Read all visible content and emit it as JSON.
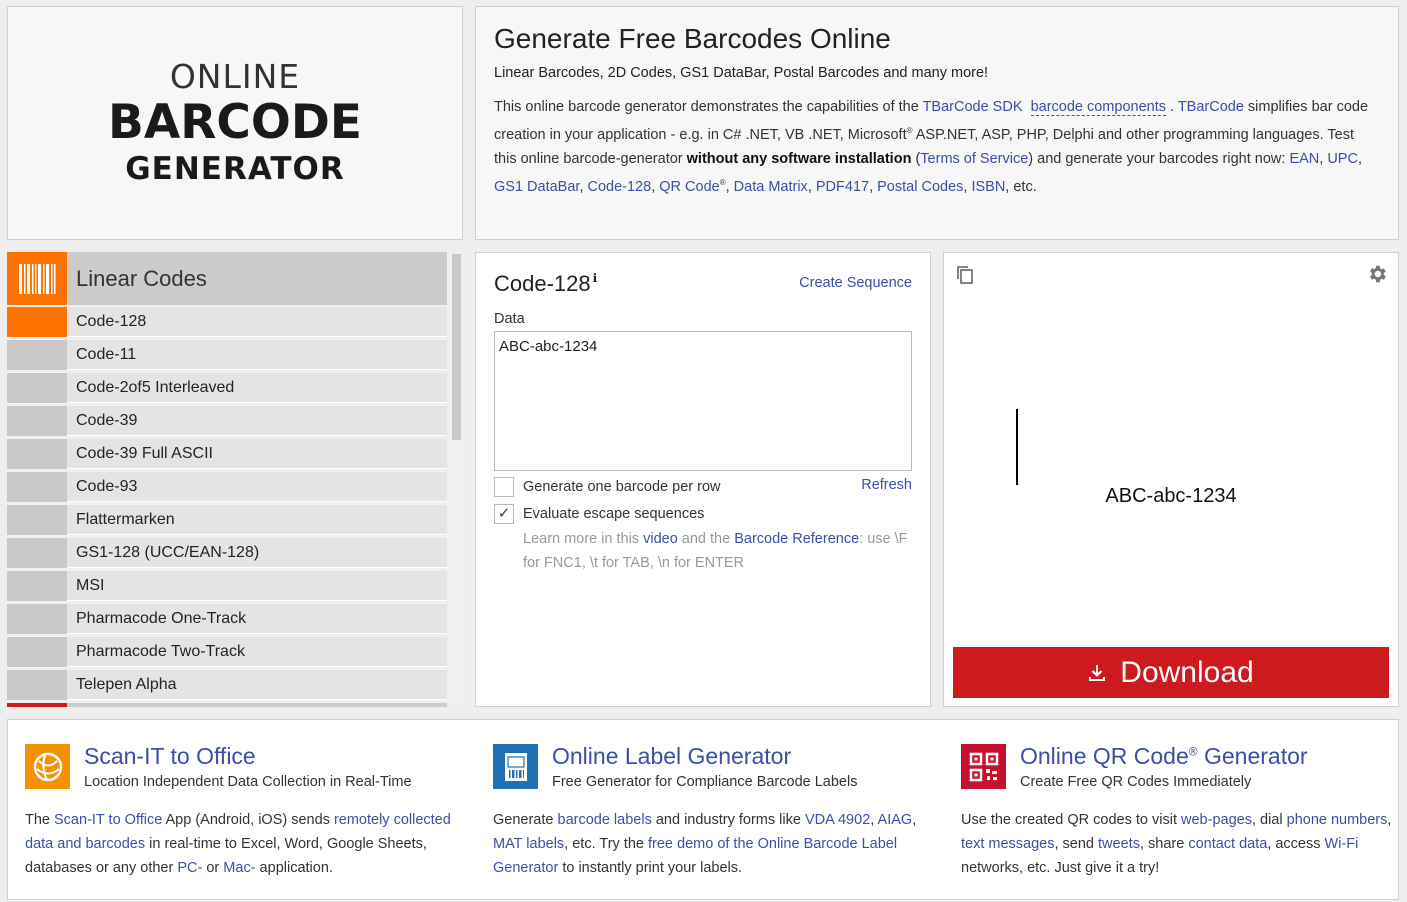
{
  "logo": {
    "line1": "ONLINE",
    "line2": "BARCODE",
    "line3": "GENERATOR"
  },
  "intro": {
    "title": "Generate Free Barcodes Online",
    "subtitle": "Linear Barcodes, 2D Codes, GS1 DataBar, Postal Barcodes and many more!",
    "p1": "This online barcode generator demonstrates the capabilities of the ",
    "tbarcode_sdk": "TBarCode SDK",
    "barcode_components": "barcode components",
    "dot": " . ",
    "tbarcode": "TBarCode",
    "p2": " simplifies bar code creation in your application - e.g. in C# .NET, VB .NET, Microsoft",
    "reg": "®",
    "p3": " ASP.NET, ASP, PHP, Delphi and other programming languages. Test this online barcode-generator ",
    "bold": "without any software installation",
    "p4": " (",
    "terms": "Terms of Service",
    "p5": ") and generate your barcodes right now: ",
    "links": [
      "EAN",
      "UPC",
      "GS1 DataBar",
      "Code-128",
      "QR Code",
      "Data Matrix",
      "PDF417",
      "Postal Codes",
      "ISBN"
    ],
    "etc": ", etc."
  },
  "list": {
    "category": "Linear Codes",
    "items": [
      "Code-128",
      "Code-11",
      "Code-2of5 Interleaved",
      "Code-39",
      "Code-39 Full ASCII",
      "Code-93",
      "Flattermarken",
      "GS1-128 (UCC/EAN-128)",
      "MSI",
      "Pharmacode One-Track",
      "Pharmacode Two-Track",
      "Telepen Alpha"
    ],
    "active_index": 0
  },
  "form": {
    "title": "Code-128",
    "create_sequence": "Create Sequence",
    "data_label": "Data",
    "data_value": "ABC-abc-1234",
    "opt1_label": "Generate one barcode per row",
    "opt1_checked": false,
    "refresh": "Refresh",
    "opt2_label": "Evaluate escape sequences",
    "opt2_checked": true,
    "hint1": "Learn more in this ",
    "hint_video": "video",
    "hint2": " and the ",
    "hint_ref": "Barcode Reference",
    "hint3": ": use \\F for FNC1, \\t for TAB, \\n for ENTER"
  },
  "preview": {
    "barcode_text": "ABC-abc-1234",
    "download_label": "Download"
  },
  "features": [
    {
      "title": "Scan-IT to Office",
      "subtitle": "Location Independent Data Collection in Real-Time",
      "icon": "scan-it-icon",
      "p_a": "The ",
      "l_a": "Scan-IT to Office",
      "p_b": " App (Android, iOS) sends ",
      "l_b": "remotely collected data and barcodes",
      "p_c": " in real-time to Excel, Word, Google Sheets, databases or any other ",
      "l_c": "PC-",
      "p_d": " or ",
      "l_d": "Mac-",
      "p_e": " application."
    },
    {
      "title": "Online Label Generator",
      "subtitle": "Free Generator for Compliance Barcode Labels",
      "icon": "label-generator-icon",
      "p_a": "Generate ",
      "l_a": "barcode labels",
      "p_b": " and industry forms like ",
      "l_b": "VDA 4902",
      "p_c": ", ",
      "l_c": "AIAG",
      "p_d": ", ",
      "l_d": "MAT labels",
      "p_e": ", etc. Try the ",
      "l_e": "free demo of the Online Barcode Label Generator",
      "p_f": " to instantly print your labels."
    },
    {
      "title": "Online QR Code",
      "title_reg": "®",
      "title_end": " Generator",
      "subtitle": "Create Free QR Codes Immediately",
      "icon": "qr-code-icon",
      "p_a": "Use the created QR codes to visit ",
      "l_a": "web-pages",
      "p_b": ", dial ",
      "l_b": "phone numbers",
      "p_c": ", ",
      "l_c": "text messages",
      "p_d": ", send ",
      "l_d": "tweets",
      "p_e": ", share ",
      "l_e": "contact data",
      "p_f": ", access ",
      "l_f": "Wi-Fi",
      "p_g": " networks, etc. Just give it a try!"
    }
  ],
  "colors": {
    "accent": "#ff7300",
    "download": "#cc1a1f",
    "link": "#3b4fa8"
  }
}
